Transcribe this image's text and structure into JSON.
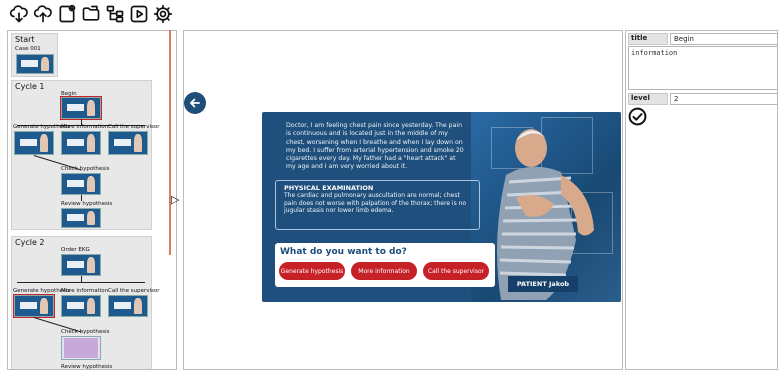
{
  "toolbar": {
    "icons": [
      "cloud-download-icon",
      "cloud-upload-icon",
      "new-page-icon",
      "folder-icon",
      "tree-icon",
      "play-icon",
      "gear-icon"
    ]
  },
  "tree": {
    "start": {
      "title": "Start",
      "node": "Case 001"
    },
    "cycle1": {
      "title": "Cycle 1",
      "root": "Begin",
      "choices": [
        "Generate hypothesis",
        "More information",
        "Call the supervisor"
      ],
      "check": "Check hypothesis",
      "review": "Review hypothesis"
    },
    "cycle2": {
      "title": "Cycle 2",
      "root": "Order EKG",
      "choices": [
        "Generate hypothesis",
        "More information",
        "Call the supervisor"
      ],
      "check": "Check hypothesis",
      "review": "Review hypothesis"
    }
  },
  "slide": {
    "speech": "Doctor, I am feeling chest pain since yesterday. The pain is continuous and is located just in the middle of my chest, worsening when I breathe and when I lay down on my bed. I suffer from arterial hypertension and smoke 20 cigarettes every day. My father had a \"heart attack\" at my age and I am very worried about it.",
    "exam_title": "PHYSICAL EXAMINATION",
    "exam_text": "The cardiac and pulmonary auscultation are normal; chest pain does not worse with palpation of the thorax; there is no jugular stasis nor lower limb edema.",
    "question": "What do you want to do?",
    "choices": [
      "Generate hypothesis",
      "More information",
      "Call the supervisor"
    ],
    "patient": "PATIENT Jakob",
    "colors": {
      "background": "#1e4f7d",
      "button": "#c62127"
    }
  },
  "properties": {
    "title_label": "title",
    "title_value": "Begin",
    "content_value": "information",
    "level_label": "level",
    "level_value": "2"
  }
}
